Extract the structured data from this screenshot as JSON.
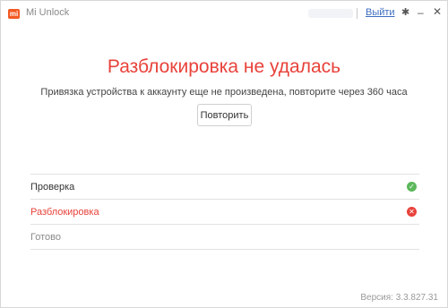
{
  "titlebar": {
    "logo": "mi",
    "app_title": "Mi Unlock",
    "logout_label": "Выйти"
  },
  "main": {
    "headline": "Разблокировка не удалась",
    "subtext": "Привязка устройства к аккаунту еще не произведена, повторите через 360 часа",
    "retry_label": "Повторить"
  },
  "steps": [
    {
      "label": "Проверка",
      "state": "success"
    },
    {
      "label": "Разблокировка",
      "state": "failed"
    },
    {
      "label": "Готово",
      "state": "pending"
    }
  ],
  "footer": {
    "version": "Версия: 3.3.827.31"
  },
  "colors": {
    "accent": "#f25a24",
    "error": "#e8423a",
    "success": "#5cb85c",
    "link": "#3c6dbf"
  },
  "icons": {
    "gear": "gear-icon",
    "minimize": "minimize-icon",
    "close": "close-icon",
    "success": "check-circle-icon",
    "failed": "x-circle-icon"
  }
}
